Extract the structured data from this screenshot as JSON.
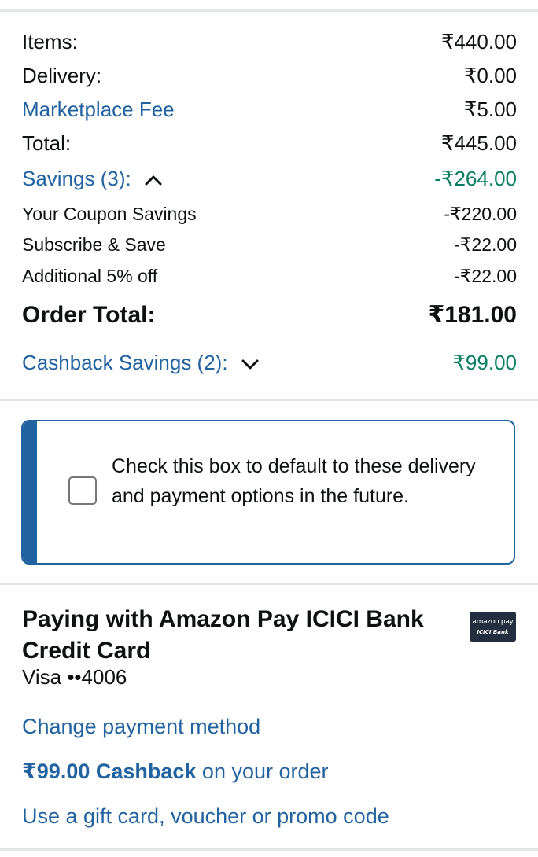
{
  "summary": {
    "items_label": "Items:",
    "items_value": "₹440.00",
    "delivery_label": "Delivery:",
    "delivery_value": "₹0.00",
    "marketplace_fee_label": "Marketplace Fee",
    "marketplace_fee_value": "₹5.00",
    "total_label": "Total:",
    "total_value": "₹445.00",
    "savings_label": "Savings (3):",
    "savings_value": "-₹264.00",
    "savings_items": [
      {
        "label": "Your Coupon Savings",
        "value": "-₹220.00"
      },
      {
        "label": "Subscribe & Save",
        "value": "-₹22.00"
      },
      {
        "label": "Additional 5% off",
        "value": "-₹22.00"
      }
    ],
    "order_total_label": "Order Total:",
    "order_total_value": "₹181.00",
    "cashback_label": "Cashback Savings (2):",
    "cashback_value": "₹99.00",
    "savings_expanded": true,
    "cashback_expanded": false
  },
  "default_option": {
    "text": "Check this box to default to these delivery and payment options in the future.",
    "checked": false
  },
  "payment": {
    "title": "Paying with Amazon Pay ICICI Bank Credit Card",
    "card": "Visa ••4006",
    "logo_line1": "amazon pay",
    "logo_line2": "ICICI Bank",
    "change_link": "Change payment method",
    "cashback_amount": "₹99.00 Cashback",
    "cashback_suffix": " on your order",
    "gift_card_link": "Use a gift card, voucher or promo code"
  },
  "colors": {
    "link": "#2162a1",
    "savings_green": "#067d62",
    "divider": "#e3e6e6"
  },
  "icons": {
    "savings_toggle": "chevron-up-icon",
    "cashback_toggle": "chevron-down-icon"
  }
}
